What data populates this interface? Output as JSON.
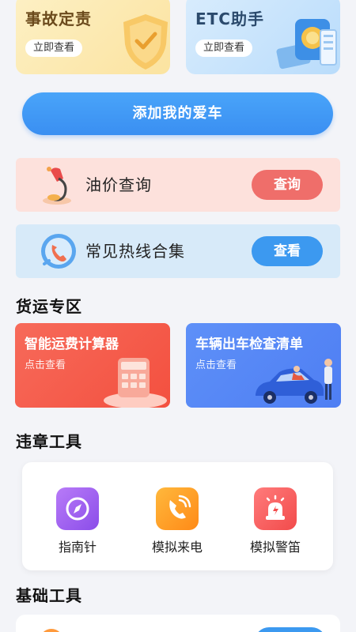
{
  "top_cards": [
    {
      "title": "事故定责",
      "button": "立即查看"
    },
    {
      "title": "ETC助手",
      "button": "立即查看"
    }
  ],
  "add_car_label": "添加我的爱车",
  "oil": {
    "label": "油价查询",
    "action": "查询"
  },
  "hotline": {
    "label": "常见热线合集",
    "action": "查看"
  },
  "freight_section": {
    "title": "货运专区",
    "cards": [
      {
        "title": "智能运费计算器",
        "subtitle": "点击查看"
      },
      {
        "title": "车辆出车检查清单",
        "subtitle": "点击查看"
      }
    ]
  },
  "violation_section": {
    "title": "违章工具",
    "tools": [
      {
        "label": "指南针",
        "icon": "compass-icon"
      },
      {
        "label": "模拟来电",
        "icon": "phone-icon"
      },
      {
        "label": "模拟警笛",
        "icon": "siren-icon"
      }
    ]
  },
  "basic_section": {
    "title": "基础工具"
  },
  "colors": {
    "primary_blue": "#3a8ff2",
    "oil_red": "#ef6e6a",
    "freight_red": "#f3503f",
    "freight_blue": "#4e7ef3",
    "page_bg": "#f3f4f8"
  }
}
